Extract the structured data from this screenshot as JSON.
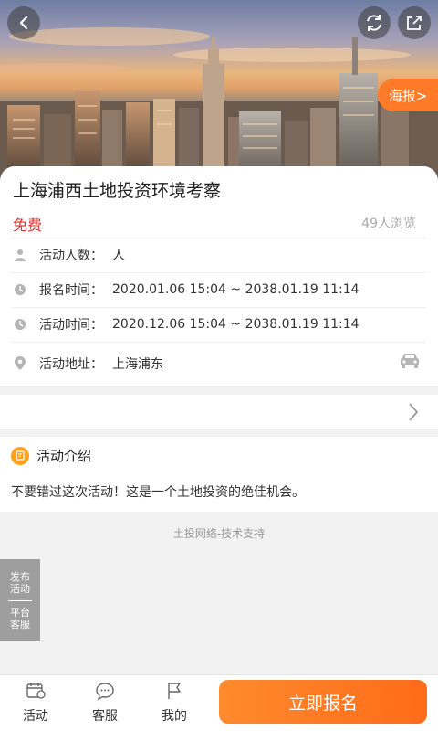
{
  "hero": {
    "poster_label": "海报>"
  },
  "event": {
    "title": "上海浦西土地投资环境考察",
    "price": "免费",
    "views": "49人浏览",
    "rows": [
      {
        "label": "活动人数：",
        "value": "人",
        "icon": "person-icon"
      },
      {
        "label": "报名时间：",
        "value": "2020.01.06 15:04 ~ 2038.01.19 11:14",
        "icon": "clock-icon"
      },
      {
        "label": "活动时间：",
        "value": "2020.12.06 15:04 ~ 2038.01.19 11:14",
        "icon": "clock-icon"
      },
      {
        "label": "活动地址：",
        "value": "上海浦东",
        "icon": "location-pin-icon"
      }
    ]
  },
  "intro": {
    "heading": "活动介绍",
    "text": "不要错过这次活动！这是一个土地投资的绝佳机会。"
  },
  "footer": {
    "support": "土投网络-技术支持",
    "side_publish": "发布活动",
    "side_service": "平台客服"
  },
  "bottom_bar": {
    "tabs": [
      {
        "label": "活动",
        "icon": "event-icon"
      },
      {
        "label": "客服",
        "icon": "chat-icon"
      },
      {
        "label": "我的",
        "icon": "flag-icon"
      }
    ],
    "signup_label": "立即报名"
  },
  "colors": {
    "accent": "#ff7b29",
    "price": "#e0302d",
    "badge": "#ffa11a"
  }
}
